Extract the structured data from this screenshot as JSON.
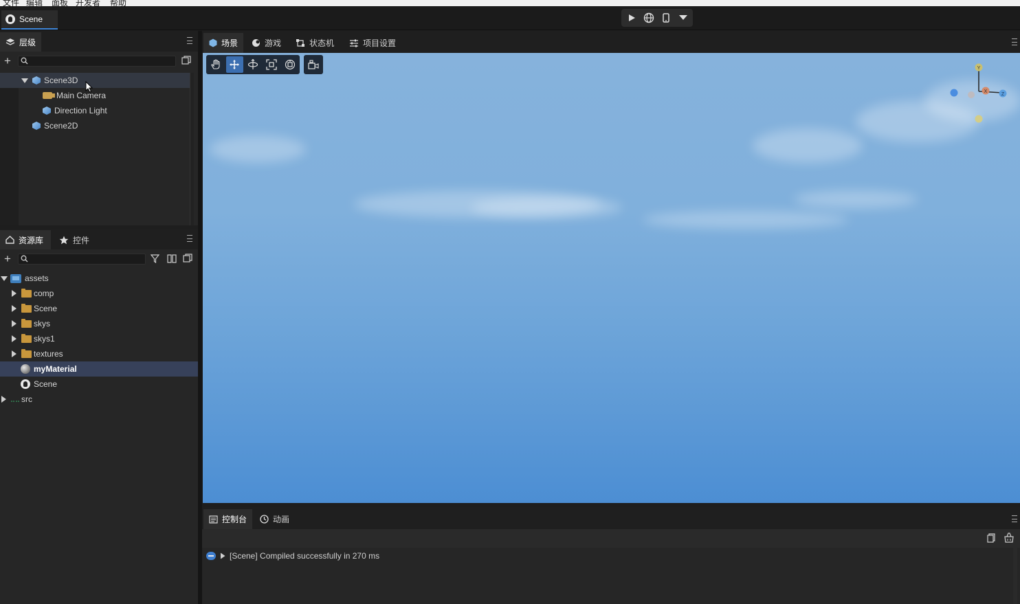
{
  "menubar": {
    "items": [
      "文件",
      "编辑",
      "面板",
      "开发者",
      "帮助"
    ]
  },
  "document": {
    "tab_label": "Scene"
  },
  "playbar": {
    "icons": [
      "play-icon",
      "globe-icon",
      "mobile-icon",
      "dropdown-arrow-icon"
    ]
  },
  "hierarchy": {
    "tab_label": "层级",
    "search_placeholder": "",
    "nodes": [
      {
        "label": "Scene3D",
        "icon": "cube-icon",
        "level": 0,
        "expanded": true
      },
      {
        "label": "Main Camera",
        "icon": "camera-icon",
        "level": 1
      },
      {
        "label": "Direction Light",
        "icon": "cube-icon",
        "level": 1
      },
      {
        "label": "Scene2D",
        "icon": "cube-icon",
        "level": 0
      }
    ]
  },
  "assets": {
    "tabs": [
      "资源库",
      "控件"
    ],
    "search_placeholder": "",
    "items": [
      {
        "label": "assets",
        "icon": "assets-icon",
        "level": 0,
        "expanded": true
      },
      {
        "label": "comp",
        "icon": "folder-icon",
        "level": 1
      },
      {
        "label": "Scene",
        "icon": "folder-icon",
        "level": 1
      },
      {
        "label": "skys",
        "icon": "folder-icon",
        "level": 1
      },
      {
        "label": "skys1",
        "icon": "folder-icon",
        "level": 1
      },
      {
        "label": "textures",
        "icon": "folder-icon",
        "level": 1
      },
      {
        "label": "myMaterial",
        "icon": "material-icon",
        "level": 1,
        "selected": true
      },
      {
        "label": "Scene",
        "icon": "scene-icon",
        "level": 1
      },
      {
        "label": "src",
        "icon": "src-icon",
        "level": 0
      }
    ]
  },
  "viewport": {
    "tabs": [
      "场景",
      "游戏",
      "状态机",
      "项目设置"
    ],
    "tools": [
      "hand-icon",
      "move-icon",
      "rotate-icon",
      "scale-icon",
      "transform-icon"
    ],
    "gizmo_axes": {
      "y": "Y",
      "x": "X",
      "z": "Z"
    }
  },
  "console": {
    "tabs": [
      "控制台",
      "动画"
    ],
    "log": "[Scene] Compiled successfully in 270 ms"
  },
  "colors": {
    "accent": "#3d84d6",
    "sky_top": "#86b2dc",
    "sky_bottom": "#4c8ed3",
    "selected_row": "#37415a",
    "folder": "#c9973c"
  }
}
